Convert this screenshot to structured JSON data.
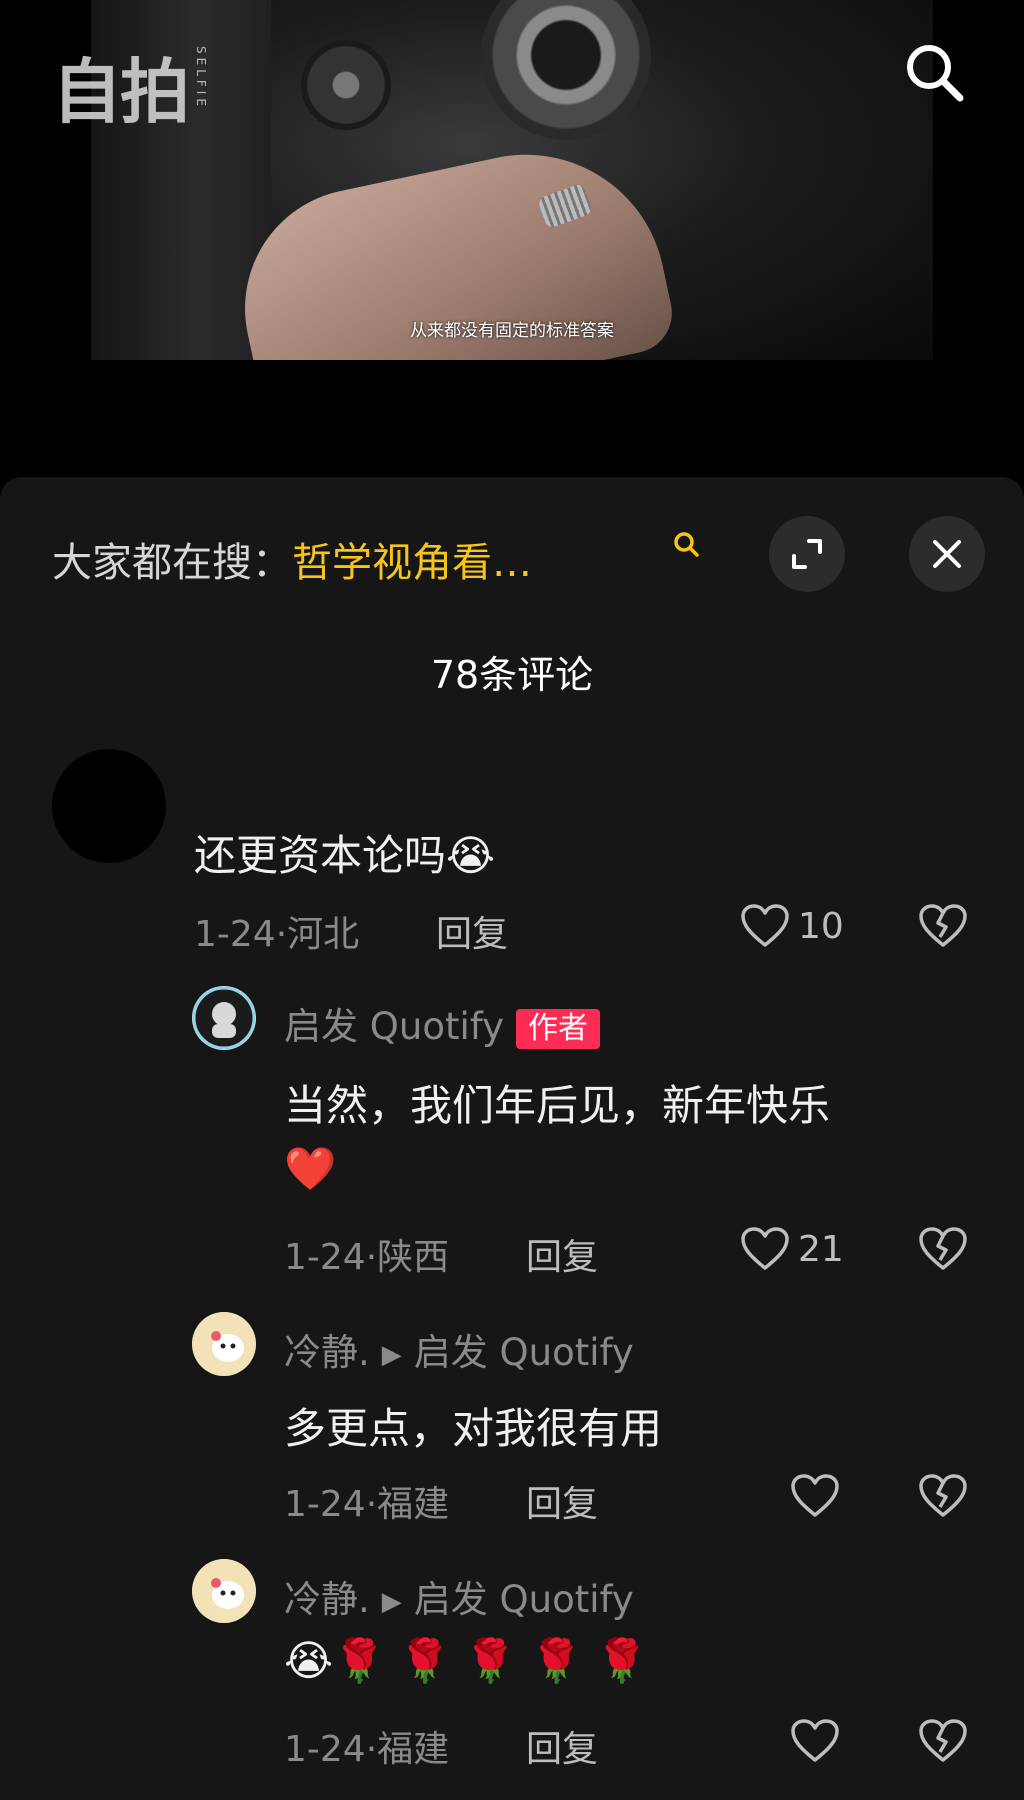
{
  "video": {
    "subtitle": "从来都没有固定的标准答案"
  },
  "logo": {
    "mark": "自拍",
    "sub": "SELFIE"
  },
  "search_hint": {
    "prefix": "大家都在搜：",
    "keyword": "哲学视角看…"
  },
  "comments_title": "78条评论",
  "comments": [
    {
      "username": "",
      "content": "还更资本论吗😭",
      "meta": "1-24·河北",
      "reply_label": "回复",
      "likes": "10"
    },
    {
      "username": "启发 Quotify",
      "tag": "作者",
      "content_line1": "当然，我们年后见，新年快乐",
      "content_line2": "❤️",
      "meta": "1-24·陕西",
      "reply_label": "回复",
      "likes": "21"
    },
    {
      "username": "冷静.",
      "reply_to": "启发 Quotify",
      "content": "多更点，对我很有用",
      "meta": "1-24·福建",
      "reply_label": "回复",
      "likes": ""
    },
    {
      "username": "冷静.",
      "reply_to": "启发 Quotify",
      "content": "😭🌹 🌹 🌹 🌹 🌹",
      "meta": "1-24·福建",
      "reply_label": "回复",
      "likes": ""
    }
  ],
  "colors": {
    "sheet_bg": "#161616",
    "keyword": "#f5c518",
    "author_tag": "#fe2c55",
    "muted_text": "#8a8a8a"
  }
}
